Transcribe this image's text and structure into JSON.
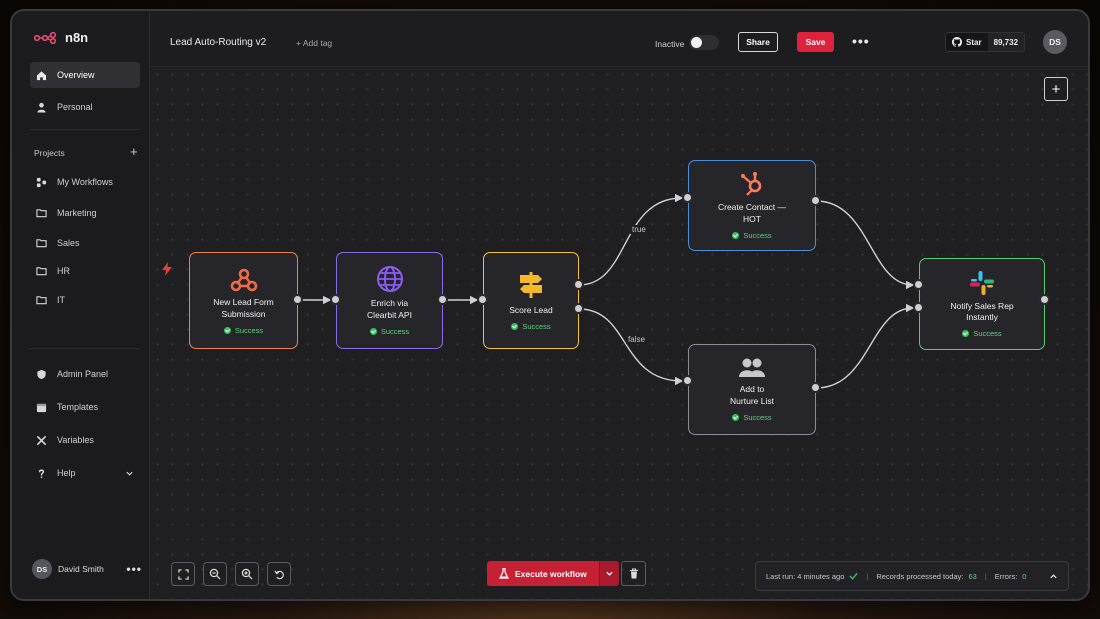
{
  "app": {
    "name": "n8n"
  },
  "sidebar": {
    "overview_label": "Overview",
    "personal_label": "Personal",
    "projects_title": "Projects",
    "projects": [
      {
        "label": "My Workflows",
        "icon": "workflows-icon"
      },
      {
        "label": "Marketing",
        "icon": "folder-icon"
      },
      {
        "label": "Sales",
        "icon": "folder-icon"
      },
      {
        "label": "HR",
        "icon": "folder-icon"
      },
      {
        "label": "IT",
        "icon": "folder-icon"
      }
    ],
    "bottom_items": [
      {
        "label": "Admin Panel",
        "icon": "shield-icon"
      },
      {
        "label": "Templates",
        "icon": "template-icon"
      },
      {
        "label": "Variables",
        "icon": "variables-icon"
      },
      {
        "label": "Help",
        "icon": "help-icon"
      }
    ],
    "user": {
      "initials": "DS",
      "name": "David Smith"
    }
  },
  "header": {
    "workflow_title": "Lead Auto-Routing v2",
    "add_tag_label": "+ Add tag",
    "active_state_label": "Inactive",
    "active": false,
    "share_label": "Share",
    "save_label": "Save",
    "github_star_label": "Star",
    "github_star_count": "89,732",
    "user_initials": "DS"
  },
  "workflow": {
    "nodes": [
      {
        "id": "trigger",
        "title_line1": "New Lead Form",
        "title_line2": "Submission",
        "status": "Success",
        "icon": "webhook-icon",
        "border_color": "#f0814a"
      },
      {
        "id": "enrich",
        "title_line1": "Enrich via",
        "title_line2": "Clearbit API",
        "status": "Success",
        "icon": "globe-icon",
        "border_color": "#8b6be8"
      },
      {
        "id": "score",
        "title_line1": "Score Lead",
        "title_line2": "",
        "status": "Success",
        "icon": "signpost-icon",
        "border_color": "#f5c23a"
      },
      {
        "id": "hubspot",
        "title_line1": "Create Contact —",
        "title_line2": "HOT",
        "status": "Success",
        "icon": "hubspot-icon",
        "border_color": "#4a8fd9"
      },
      {
        "id": "nurture",
        "title_line1": "Add to",
        "title_line2": "Nurture List",
        "status": "Success",
        "icon": "users-icon",
        "border_color": "#8d8d93"
      },
      {
        "id": "slack",
        "title_line1": "Notify Sales Rep",
        "title_line2": "Instantly",
        "status": "Success",
        "icon": "slack-icon",
        "border_color": "#4fcf72"
      }
    ],
    "branch_true_label": "true",
    "branch_false_label": "false"
  },
  "footer": {
    "execute_label": "Execute workflow",
    "last_run_label": "Last run: 4 minutes ago",
    "records_label": "Records processed today:",
    "records_value": "63",
    "errors_label": "Errors:",
    "errors_value": "0"
  },
  "colors": {
    "accent": "#e0213b",
    "success": "#3bbf5e"
  }
}
